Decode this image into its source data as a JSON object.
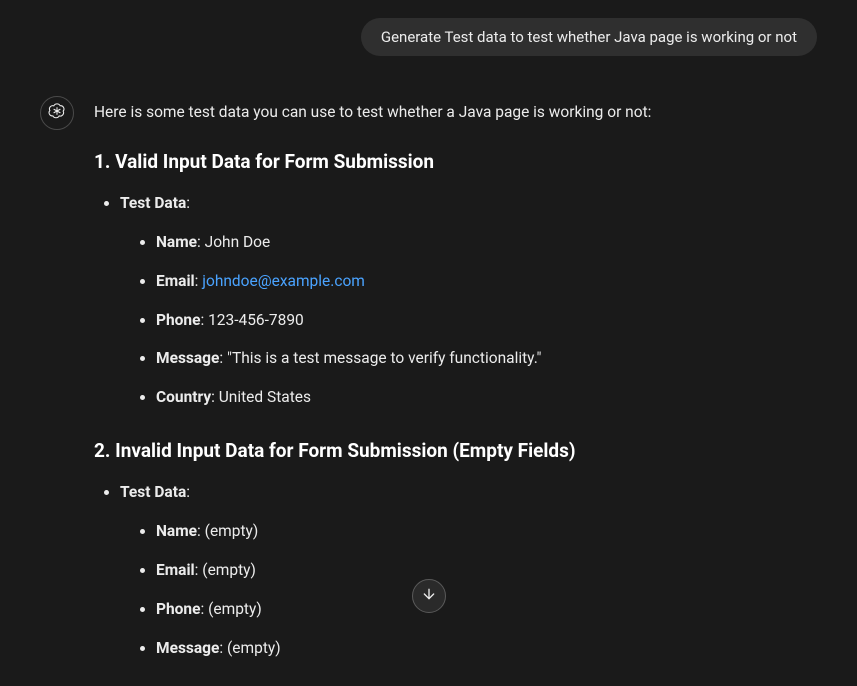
{
  "user_message": "Generate Test data to test whether Java page is working or not",
  "assistant": {
    "intro": "Here is some test data you can use to test whether a Java page is working or not:",
    "sections": [
      {
        "num": "1.",
        "title": "Valid Input Data for Form Submission",
        "test_data_label": "Test Data",
        "items": [
          {
            "label": "Name",
            "value": "John Doe",
            "is_link": false
          },
          {
            "label": "Email",
            "value": "johndoe@example.com",
            "is_link": true
          },
          {
            "label": "Phone",
            "value": "123-456-7890",
            "is_link": false
          },
          {
            "label": "Message",
            "value": "\"This is a test message to verify functionality.\"",
            "is_link": false
          },
          {
            "label": "Country",
            "value": "United States",
            "is_link": false
          }
        ]
      },
      {
        "num": "2.",
        "title": "Invalid Input Data for Form Submission (Empty Fields)",
        "test_data_label": "Test Data",
        "items": [
          {
            "label": "Name",
            "value": "(empty)",
            "is_link": false
          },
          {
            "label": "Email",
            "value": "(empty)",
            "is_link": false
          },
          {
            "label": "Phone",
            "value": "(empty)",
            "is_link": false
          },
          {
            "label": "Message",
            "value": "(empty)",
            "is_link": false
          }
        ]
      }
    ]
  },
  "colors": {
    "link": "#4aa3ff",
    "bg": "#1a1a1a",
    "bubble": "#2f2f2f"
  }
}
